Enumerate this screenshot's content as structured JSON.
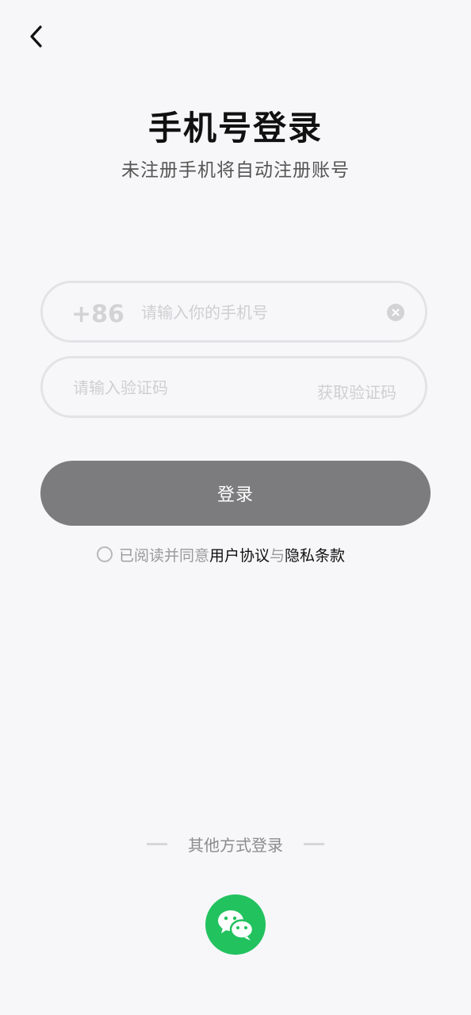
{
  "header": {
    "back_icon": "chevron-left-icon"
  },
  "main": {
    "title": "手机号登录",
    "subtitle": "未注册手机将自动注册账号"
  },
  "phone_field": {
    "country_code": "+86",
    "value": "",
    "placeholder": "请输入你的手机号",
    "clear_icon": "clear-circle-icon"
  },
  "code_field": {
    "value": "",
    "placeholder": "请输入验证码",
    "get_code_label": "获取验证码"
  },
  "login_button": {
    "label": "登录"
  },
  "agreement": {
    "prefix": "已阅读并同意",
    "user_agreement": "用户协议",
    "connector": "与",
    "privacy_terms": "隐私条款",
    "checked": false
  },
  "other_login": {
    "label": "其他方式登录",
    "wechat_icon": "wechat-icon"
  },
  "colors": {
    "background": "#f7f7f9",
    "login_button": "#7c7c7e",
    "wechat": "#22c25f",
    "border": "#e3e3e6"
  }
}
